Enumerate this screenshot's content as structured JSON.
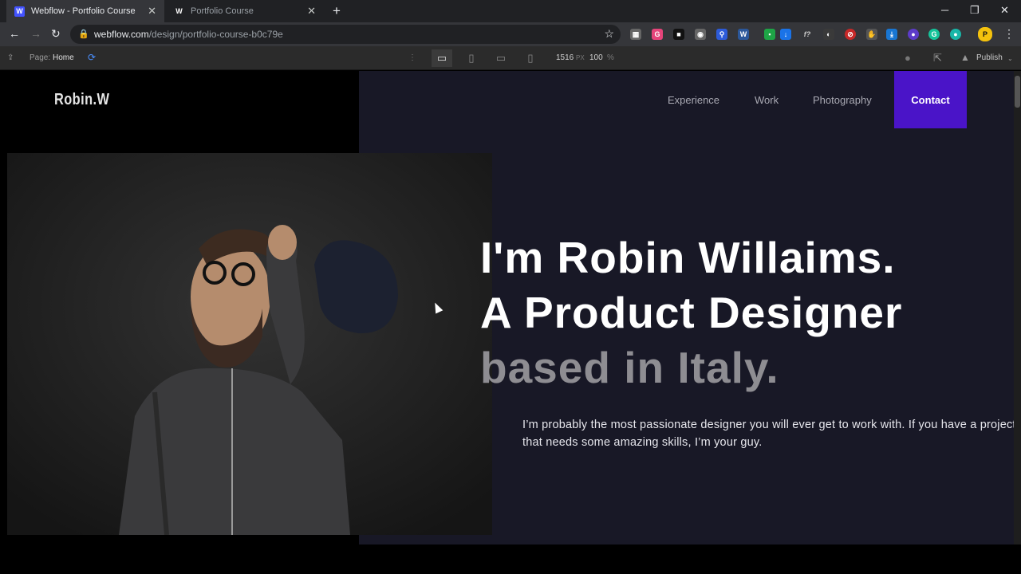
{
  "browser": {
    "tabs": [
      {
        "title": "Webflow - Portfolio Course",
        "favicon": "W",
        "active": true
      },
      {
        "title": "Portfolio Course",
        "favicon": "W",
        "active": false
      }
    ],
    "url_host": "webflow.com",
    "url_path": "/design/portfolio-course-b0c79e"
  },
  "designer": {
    "page_label": "Page:",
    "page_name": "Home",
    "width_value": "1516",
    "width_unit": "PX",
    "zoom_value": "100",
    "zoom_unit": "%",
    "publish_label": "Publish"
  },
  "site": {
    "logo": "Robin.W",
    "nav": {
      "experience": "Experience",
      "work": "Work",
      "photography": "Photography",
      "contact": "Contact"
    },
    "hero": {
      "line1": "I'm Robin Willaims.",
      "line2": "A Product Designer",
      "line3": "based in Italy.",
      "intro": "I’m probably the most passionate designer you will ever get to work with. If you have a project that needs some amazing skills, I’m your guy."
    },
    "colors": {
      "background": "#181826",
      "accent": "#4a14c8",
      "muted_heading": "#8e8d92"
    }
  }
}
